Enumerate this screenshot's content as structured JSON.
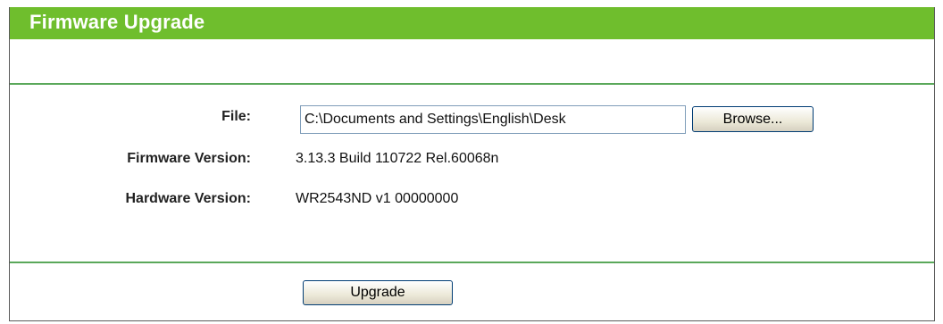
{
  "header": {
    "title": "Firmware Upgrade"
  },
  "form": {
    "file_label": "File:",
    "file_value": "C:\\Documents and Settings\\English\\Desk",
    "browse_label": "Browse...",
    "firmware_label": "Firmware Version:",
    "firmware_value": "3.13.3 Build 110722 Rel.60068n",
    "hardware_label": "Hardware Version:",
    "hardware_value": "WR2543ND v1 00000000",
    "upgrade_label": "Upgrade"
  },
  "colors": {
    "header_bg": "#6fbe2d",
    "divider": "#5aa85a"
  }
}
